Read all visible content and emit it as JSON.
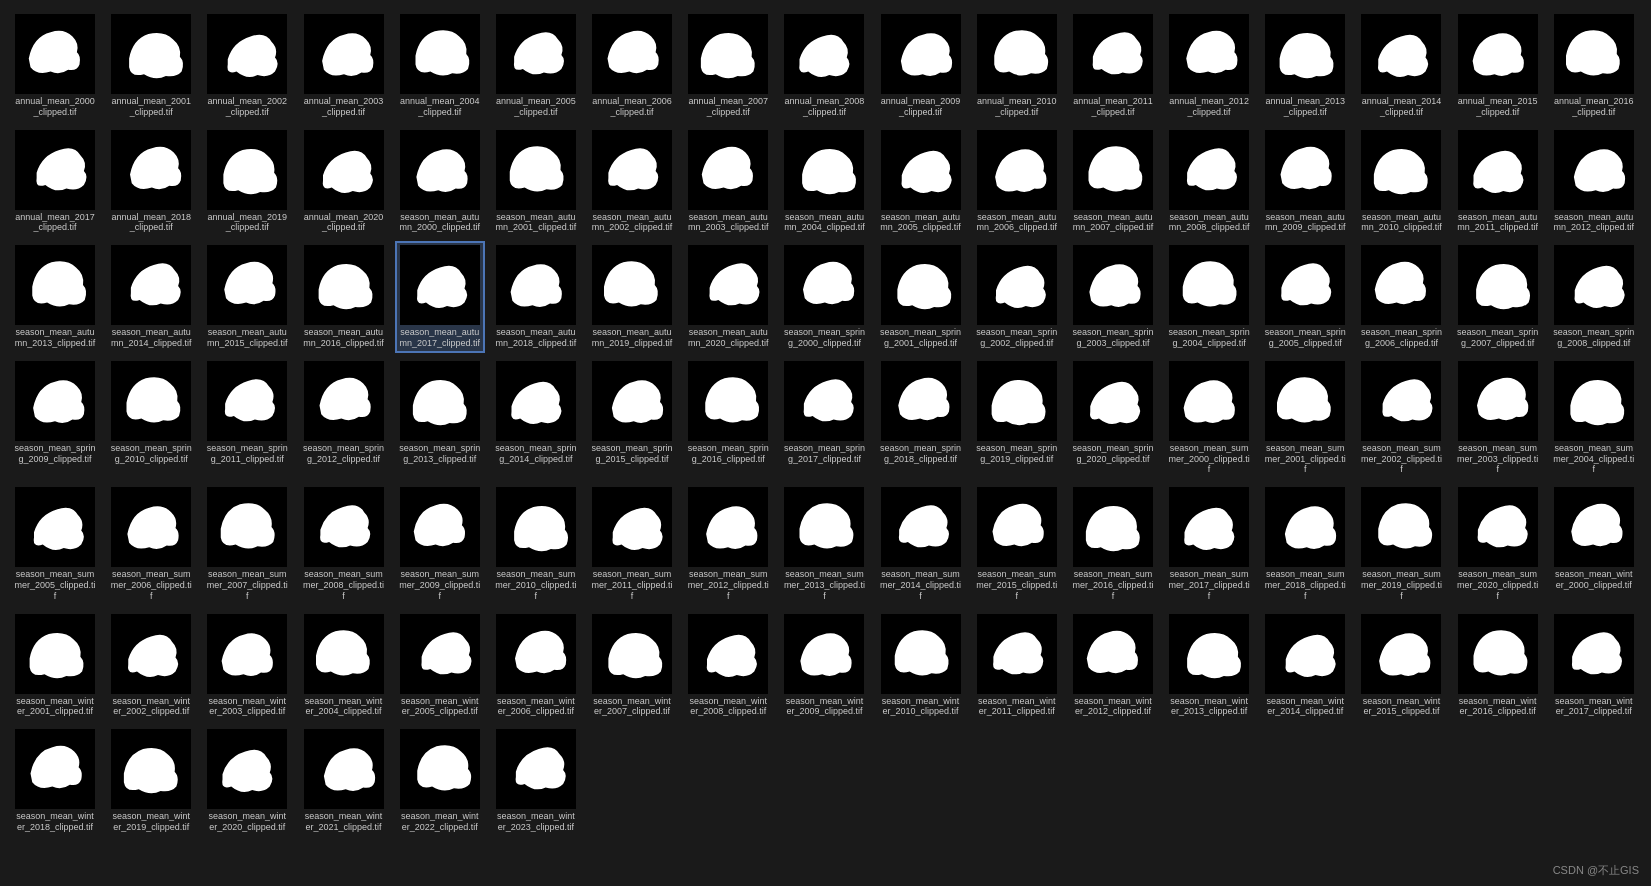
{
  "watermark": "CSDN @不止GIS",
  "files": [
    {
      "name": "annual_mean_2000_clipped.tif",
      "selected": false
    },
    {
      "name": "annual_mean_2001_clipped.tif",
      "selected": false
    },
    {
      "name": "annual_mean_2002_clipped.tif",
      "selected": false
    },
    {
      "name": "annual_mean_2003_clipped.tif",
      "selected": false
    },
    {
      "name": "annual_mean_2004_clipped.tif",
      "selected": false
    },
    {
      "name": "annual_mean_2005_clipped.tif",
      "selected": false
    },
    {
      "name": "annual_mean_2006_clipped.tif",
      "selected": false
    },
    {
      "name": "annual_mean_2007_clipped.tif",
      "selected": false
    },
    {
      "name": "annual_mean_2008_clipped.tif",
      "selected": false
    },
    {
      "name": "annual_mean_2009_clipped.tif",
      "selected": false
    },
    {
      "name": "annual_mean_2010_clipped.tif",
      "selected": false
    },
    {
      "name": "annual_mean_2011_clipped.tif",
      "selected": false
    },
    {
      "name": "annual_mean_2012_clipped.tif",
      "selected": false
    },
    {
      "name": "annual_mean_2013_clipped.tif",
      "selected": false
    },
    {
      "name": "annual_mean_2014_clipped.tif",
      "selected": false
    },
    {
      "name": "annual_mean_2015_clipped.tif",
      "selected": false
    },
    {
      "name": "annual_mean_2016_clipped.tif",
      "selected": false
    },
    {
      "name": "annual_mean_2017_clipped.tif",
      "selected": false
    },
    {
      "name": "annual_mean_2018_clipped.tif",
      "selected": false
    },
    {
      "name": "annual_mean_2019_clipped.tif",
      "selected": false
    },
    {
      "name": "annual_mean_2020_clipped.tif",
      "selected": false
    },
    {
      "name": "season_mean_autumn_2000_clipped.tif",
      "selected": false
    },
    {
      "name": "season_mean_autumn_2001_clipped.tif",
      "selected": false
    },
    {
      "name": "season_mean_autumn_2002_clipped.tif",
      "selected": false
    },
    {
      "name": "season_mean_autumn_2003_clipped.tif",
      "selected": false
    },
    {
      "name": "season_mean_autumn_2004_clipped.tif",
      "selected": false
    },
    {
      "name": "season_mean_autumn_2005_clipped.tif",
      "selected": false
    },
    {
      "name": "season_mean_autumn_2006_clipped.tif",
      "selected": false
    },
    {
      "name": "season_mean_autumn_2007_clipped.tif",
      "selected": false
    },
    {
      "name": "season_mean_autumn_2008_clipped.tif",
      "selected": false
    },
    {
      "name": "season_mean_autumn_2009_clipped.tif",
      "selected": false
    },
    {
      "name": "season_mean_autumn_2010_clipped.tif",
      "selected": false
    },
    {
      "name": "season_mean_autumn_2011_clipped.tif",
      "selected": false
    },
    {
      "name": "season_mean_autumn_2012_clipped.tif",
      "selected": false
    },
    {
      "name": "season_mean_autumn_2013_clipped.tif",
      "selected": false
    },
    {
      "name": "season_mean_autumn_2014_clipped.tif",
      "selected": false
    },
    {
      "name": "season_mean_autumn_2015_clipped.tif",
      "selected": false
    },
    {
      "name": "season_mean_autumn_2016_clipped.tif",
      "selected": false
    },
    {
      "name": "season_mean_autumn_2017_clipped.tif",
      "selected": true
    },
    {
      "name": "season_mean_autumn_2018_clipped.tif",
      "selected": false
    },
    {
      "name": "season_mean_autumn_2019_clipped.tif",
      "selected": false
    },
    {
      "name": "season_mean_autumn_2020_clipped.tif",
      "selected": false
    },
    {
      "name": "season_mean_spring_2000_clipped.tif",
      "selected": false
    },
    {
      "name": "season_mean_spring_2001_clipped.tif",
      "selected": false
    },
    {
      "name": "season_mean_spring_2002_clipped.tif",
      "selected": false
    },
    {
      "name": "season_mean_spring_2003_clipped.tif",
      "selected": false
    },
    {
      "name": "season_mean_spring_2004_clipped.tif",
      "selected": false
    },
    {
      "name": "season_mean_spring_2005_clipped.tif",
      "selected": false
    },
    {
      "name": "season_mean_spring_2006_clipped.tif",
      "selected": false
    },
    {
      "name": "season_mean_spring_2007_clipped.tif",
      "selected": false
    },
    {
      "name": "season_mean_spring_2008_clipped.tif",
      "selected": false
    },
    {
      "name": "season_mean_spring_2009_clipped.tif",
      "selected": false
    },
    {
      "name": "season_mean_spring_2010_clipped.tif",
      "selected": false
    },
    {
      "name": "season_mean_spring_2011_clipped.tif",
      "selected": false
    },
    {
      "name": "season_mean_spring_2012_clipped.tif",
      "selected": false
    },
    {
      "name": "season_mean_spring_2013_clipped.tif",
      "selected": false
    },
    {
      "name": "season_mean_spring_2014_clipped.tif",
      "selected": false
    },
    {
      "name": "season_mean_spring_2015_clipped.tif",
      "selected": false
    },
    {
      "name": "season_mean_spring_2016_clipped.tif",
      "selected": false
    },
    {
      "name": "season_mean_spring_2017_clipped.tif",
      "selected": false
    },
    {
      "name": "season_mean_spring_2018_clipped.tif",
      "selected": false
    },
    {
      "name": "season_mean_spring_2019_clipped.tif",
      "selected": false
    },
    {
      "name": "season_mean_spring_2020_clipped.tif",
      "selected": false
    },
    {
      "name": "season_mean_summer_2000_clipped.tif",
      "selected": false
    },
    {
      "name": "season_mean_summer_2001_clipped.tif",
      "selected": false
    },
    {
      "name": "season_mean_summer_2002_clipped.tif",
      "selected": false
    },
    {
      "name": "season_mean_summer_2003_clipped.tif",
      "selected": false
    },
    {
      "name": "season_mean_summer_2004_clipped.tif",
      "selected": false
    },
    {
      "name": "season_mean_summer_2005_clipped.tif",
      "selected": false
    },
    {
      "name": "season_mean_summer_2006_clipped.tif",
      "selected": false
    },
    {
      "name": "season_mean_summer_2007_clipped.tif",
      "selected": false
    },
    {
      "name": "season_mean_summer_2008_clipped.tif",
      "selected": false
    },
    {
      "name": "season_mean_summer_2009_clipped.tif",
      "selected": false
    },
    {
      "name": "season_mean_summer_2010_clipped.tif",
      "selected": false
    },
    {
      "name": "season_mean_summer_2011_clipped.tif",
      "selected": false
    },
    {
      "name": "season_mean_summer_2012_clipped.tif",
      "selected": false
    },
    {
      "name": "season_mean_summer_2013_clipped.tif",
      "selected": false
    },
    {
      "name": "season_mean_summer_2014_clipped.tif",
      "selected": false
    },
    {
      "name": "season_mean_summer_2015_clipped.tif",
      "selected": false
    },
    {
      "name": "season_mean_summer_2016_clipped.tif",
      "selected": false
    },
    {
      "name": "season_mean_summer_2017_clipped.tif",
      "selected": false
    },
    {
      "name": "season_mean_summer_2018_clipped.tif",
      "selected": false
    },
    {
      "name": "season_mean_summer_2019_clipped.tif",
      "selected": false
    },
    {
      "name": "season_mean_summer_2020_clipped.tif",
      "selected": false
    },
    {
      "name": "season_mean_winter_2000_clipped.tif",
      "selected": false
    },
    {
      "name": "season_mean_winter_2001_clipped.tif",
      "selected": false
    },
    {
      "name": "season_mean_winter_2002_clipped.tif",
      "selected": false
    },
    {
      "name": "season_mean_winter_2003_clipped.tif",
      "selected": false
    },
    {
      "name": "season_mean_winter_2004_clipped.tif",
      "selected": false
    },
    {
      "name": "season_mean_winter_2005_clipped.tif",
      "selected": false
    },
    {
      "name": "season_mean_winter_2006_clipped.tif",
      "selected": false
    },
    {
      "name": "season_mean_winter_2007_clipped.tif",
      "selected": false
    },
    {
      "name": "season_mean_winter_2008_clipped.tif",
      "selected": false
    },
    {
      "name": "season_mean_winter_2009_clipped.tif",
      "selected": false
    },
    {
      "name": "season_mean_winter_2010_clipped.tif",
      "selected": false
    },
    {
      "name": "season_mean_winter_2011_clipped.tif",
      "selected": false
    },
    {
      "name": "season_mean_winter_2012_clipped.tif",
      "selected": false
    },
    {
      "name": "season_mean_winter_2013_clipped.tif",
      "selected": false
    },
    {
      "name": "season_mean_winter_2014_clipped.tif",
      "selected": false
    },
    {
      "name": "season_mean_winter_2015_clipped.tif",
      "selected": false
    },
    {
      "name": "season_mean_winter_2016_clipped.tif",
      "selected": false
    },
    {
      "name": "season_mean_winter_2017_clipped.tif",
      "selected": false
    },
    {
      "name": "season_mean_winter_2018_clipped.tif",
      "selected": false
    },
    {
      "name": "season_mean_winter_2019_clipped.tif",
      "selected": false
    },
    {
      "name": "season_mean_winter_2020_clipped.tif",
      "selected": false
    },
    {
      "name": "season_mean_winter_2021_clipped.tif",
      "selected": false
    },
    {
      "name": "season_mean_winter_2022_clipped.tif",
      "selected": false
    },
    {
      "name": "season_mean_winter_2023_clipped.tif",
      "selected": false
    }
  ]
}
